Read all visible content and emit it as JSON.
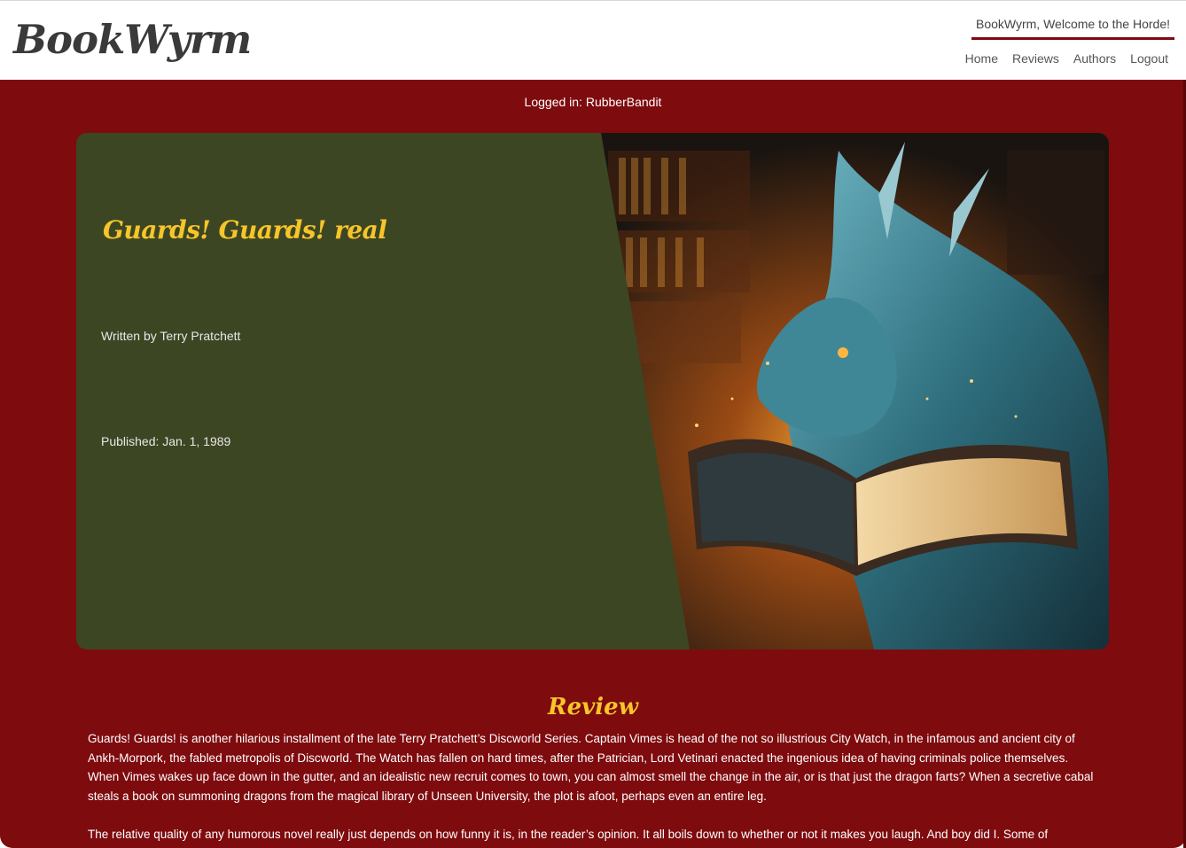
{
  "header": {
    "logo": "BookWyrm",
    "welcome": "BookWyrm, Welcome to the Horde!",
    "nav": [
      "Home",
      "Reviews",
      "Authors",
      "Logout"
    ]
  },
  "session": {
    "logged_in": "Logged in: RubberBandit"
  },
  "book": {
    "title": "Guards! Guards! real",
    "author": "Written by Terry Pratchett",
    "published": "Published: Jan. 1, 1989",
    "image": "dragon-reading-book-in-library"
  },
  "review": {
    "heading": "Review",
    "paragraphs": [
      "Guards! Guards! is another hilarious installment of the late Terry Pratchett’s Discworld Series. Captain Vimes is head of the not so illustrious City Watch, in the infamous and ancient city of Ankh-Morpork, the fabled metropolis of Discworld. The Watch has fallen on hard times, after the Patrician, Lord Vetinari enacted the ingenious idea of having criminals police themselves. When Vimes wakes up face down in the gutter, and an idealistic new recruit comes to town, you can almost smell the change in the air, or is that just the dragon farts? When a secretive cabal steals a book on summoning dragons from the magical library of Unseen University, the plot is afoot, perhaps even an entire leg.",
      "The relative quality of any humorous novel really just depends on how funny it is, in the reader’s opinion. It all boils down to whether or not it makes you laugh. And boy did I. Some of"
    ]
  },
  "colors": {
    "brand_red": "#7e0b0e",
    "panel_green": "#3d4623",
    "accent_gold": "#f6c52a"
  }
}
